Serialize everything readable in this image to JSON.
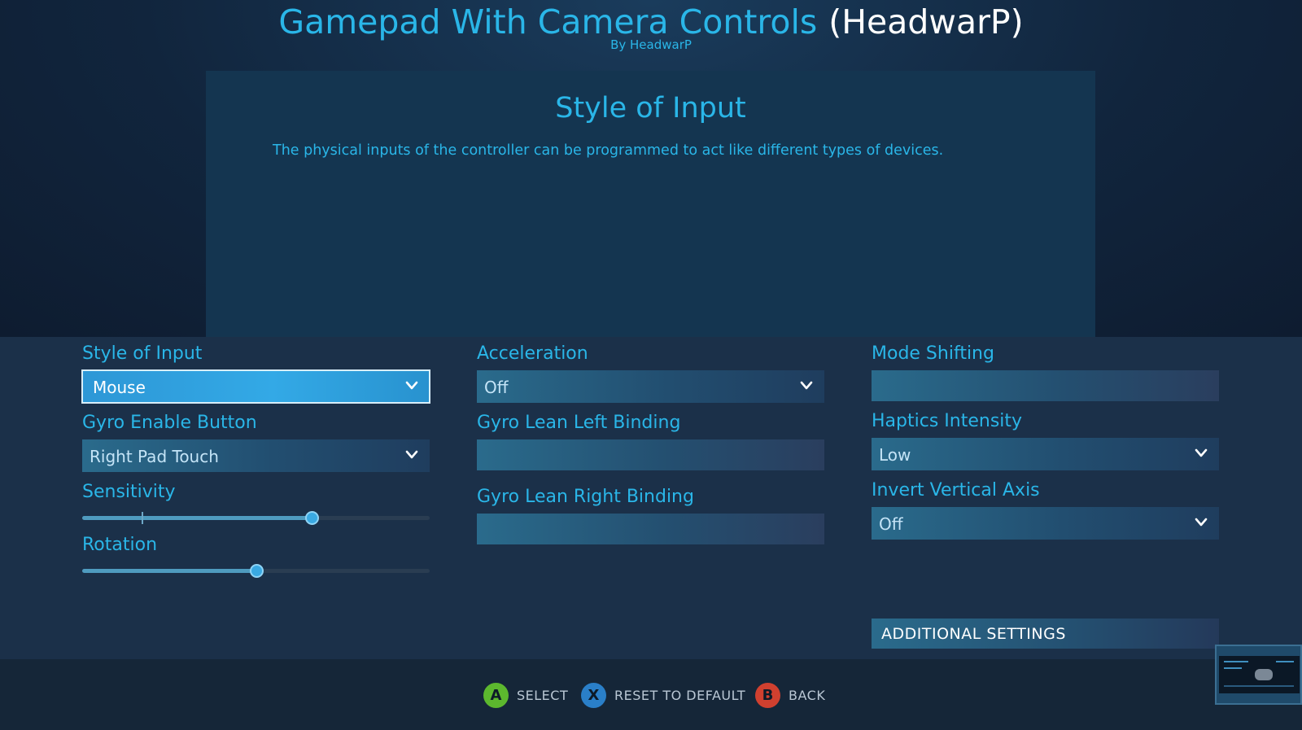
{
  "header": {
    "title": "Gamepad With Camera Controls",
    "owner": "(HeadwarP)",
    "byline": "By HeadwarP"
  },
  "info": {
    "title": "Style of Input",
    "description": "The physical inputs of the controller can be programmed to act like different types of devices."
  },
  "settings": {
    "style_of_input": {
      "label": "Style of Input",
      "value": "Mouse"
    },
    "gyro_enable_button": {
      "label": "Gyro Enable Button",
      "value": "Right Pad Touch"
    },
    "sensitivity": {
      "label": "Sensitivity",
      "level": 0.66,
      "default_mark": 0.17
    },
    "rotation": {
      "label": "Rotation",
      "level": 0.5
    },
    "acceleration": {
      "label": "Acceleration",
      "value": "Off"
    },
    "gyro_lean_left": {
      "label": "Gyro Lean Left Binding",
      "value": ""
    },
    "gyro_lean_right": {
      "label": "Gyro Lean Right Binding",
      "value": ""
    },
    "mode_shifting": {
      "label": "Mode Shifting",
      "value": ""
    },
    "haptics_intensity": {
      "label": "Haptics Intensity",
      "value": "Low"
    },
    "invert_vertical_axis": {
      "label": "Invert Vertical Axis",
      "value": "Off"
    },
    "additional_settings_label": "ADDITIONAL SETTINGS"
  },
  "footer": {
    "select": {
      "button": "A",
      "label": "SELECT",
      "color": "#5cb82e"
    },
    "reset": {
      "button": "X",
      "label": "RESET TO DEFAULT",
      "color": "#2a7fc8"
    },
    "back": {
      "button": "B",
      "label": "BACK",
      "color": "#d0402f"
    }
  },
  "colors": {
    "accent": "#2ab6e8",
    "selected_field": "#33a9e6"
  }
}
